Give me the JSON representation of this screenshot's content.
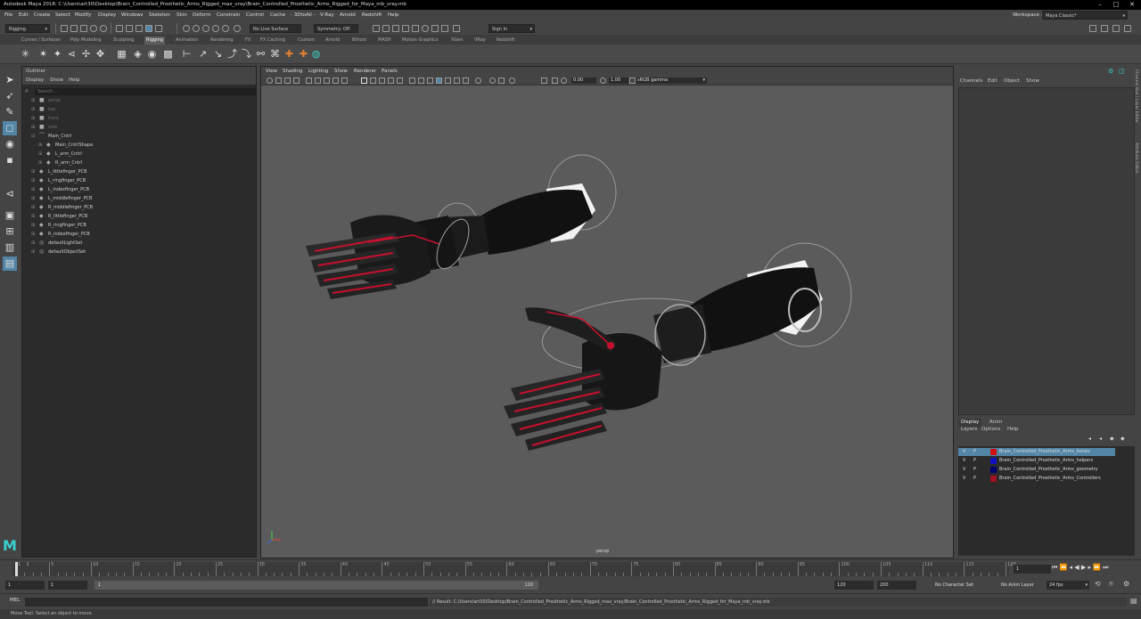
{
  "window": {
    "title": "Autodesk Maya 2018: C:\\Users\\art30\\Desktop\\Brain_Controlled_Prosthetic_Arms_Rigged_max_vray\\Brain_Controlled_Prosthetic_Arms_Rigged_for_Maya_mb_vray.mb"
  },
  "menubar": {
    "items": [
      "File",
      "Edit",
      "Create",
      "Select",
      "Modify",
      "Display",
      "Windows",
      "Skeleton",
      "Skin",
      "Deform",
      "Constrain",
      "Control",
      "Cache",
      "- 3DtoAll -",
      "V-Ray",
      "Arnold",
      "Redshift",
      "Help"
    ],
    "workspace_label": "Workspace :",
    "workspace_value": "Maya Classic*"
  },
  "toolbar": {
    "menuset": "Rigging",
    "live_surface": "No Live Surface",
    "symmetry": "Symmetry: Off",
    "sign_in": "Sign In"
  },
  "shelf": {
    "tabs": [
      "Curves / Surfaces",
      "Poly Modeling",
      "Sculpting",
      "Rigging",
      "Animation",
      "Rendering",
      "FX",
      "FX Caching",
      "Custom",
      "Arnold",
      "Bifrost",
      "MASH",
      "Motion Graphics",
      "XGen",
      "VRay",
      "Redshift"
    ],
    "active_tab": "Rigging"
  },
  "outliner": {
    "title": "Outliner",
    "menu": [
      "Display",
      "Show",
      "Help"
    ],
    "search_placeholder": "Search...",
    "items": [
      {
        "label": "persp",
        "dim": true,
        "indent": 0,
        "icon": "camera"
      },
      {
        "label": "top",
        "dim": true,
        "indent": 0,
        "icon": "camera"
      },
      {
        "label": "front",
        "dim": true,
        "indent": 0,
        "icon": "camera"
      },
      {
        "label": "side",
        "dim": true,
        "indent": 0,
        "icon": "camera"
      },
      {
        "label": "Main_Cntrl",
        "dim": false,
        "indent": 0,
        "icon": "curve",
        "expanded": true
      },
      {
        "label": "Main_CntrlShape",
        "dim": false,
        "indent": 1,
        "icon": "shape"
      },
      {
        "label": "L_arm_Cntrl",
        "dim": false,
        "indent": 1,
        "icon": "shape"
      },
      {
        "label": "R_arm_Cntrl",
        "dim": false,
        "indent": 1,
        "icon": "shape"
      },
      {
        "label": "L_littlefinger_PCB",
        "dim": false,
        "indent": 0,
        "icon": "shape"
      },
      {
        "label": "L_ringfinger_PCB",
        "dim": false,
        "indent": 0,
        "icon": "shape"
      },
      {
        "label": "L_indexfinger_PCB",
        "dim": false,
        "indent": 0,
        "icon": "shape"
      },
      {
        "label": "L_middlefinger_PCB",
        "dim": false,
        "indent": 0,
        "icon": "shape"
      },
      {
        "label": "R_middlefinger_PCB",
        "dim": false,
        "indent": 0,
        "icon": "shape"
      },
      {
        "label": "R_littlefinger_PCB",
        "dim": false,
        "indent": 0,
        "icon": "shape"
      },
      {
        "label": "R_ringfinger_PCB",
        "dim": false,
        "indent": 0,
        "icon": "shape"
      },
      {
        "label": "R_indexfinger_PCB",
        "dim": false,
        "indent": 0,
        "icon": "shape"
      },
      {
        "label": "defaultLightSet",
        "dim": false,
        "indent": 0,
        "icon": "set"
      },
      {
        "label": "defaultObjectSet",
        "dim": false,
        "indent": 0,
        "icon": "set"
      }
    ]
  },
  "viewport": {
    "menu": [
      "View",
      "Shading",
      "Lighting",
      "Show",
      "Renderer",
      "Panels"
    ],
    "exposure": "0.00",
    "gamma": "1.00",
    "colorspace": "sRGB gamma",
    "camera": "persp"
  },
  "channelbox": {
    "menu": [
      "Channels",
      "Edit",
      "Object",
      "Show"
    ],
    "side_tabs": [
      "Channel Box / Layer Editor",
      "Attribute Editor"
    ]
  },
  "layer_editor": {
    "tabs": [
      "Display",
      "Anim"
    ],
    "menu": [
      "Layers",
      "Options",
      "Help"
    ],
    "layers": [
      {
        "v": "V",
        "p": "P",
        "name": "Brain_Controlled_Prosthetic_Arms_bones",
        "color": "#d01010",
        "selected": true
      },
      {
        "v": "V",
        "p": "P",
        "name": "Brain_Controlled_Prosthetic_Arms_helpers",
        "color": "#1010c0",
        "selected": false
      },
      {
        "v": "V",
        "p": "P",
        "name": "Brain_Controlled_Prosthetic_Arms_geometry",
        "color": "#000070",
        "selected": false
      },
      {
        "v": "V",
        "p": "P",
        "name": "Brain_Controlled_Prosthetic_Arms_Controllers",
        "color": "#a01020",
        "selected": false
      }
    ]
  },
  "timeslider": {
    "ticks": [
      "1",
      "2",
      "5",
      "10",
      "15",
      "20",
      "25",
      "30",
      "35",
      "40",
      "45",
      "50",
      "55",
      "60",
      "65",
      "70",
      "75",
      "80",
      "85",
      "90",
      "95",
      "100",
      "105",
      "110",
      "115",
      "120"
    ],
    "current_frame": "1"
  },
  "range": {
    "start": "1",
    "inner_start": "1",
    "slider_start": "1",
    "slider_end": "120",
    "end": "120",
    "outer_end": "200",
    "character_set": "No Character Set",
    "anim_layer": "No Anim Layer",
    "fps": "24 fps"
  },
  "commandline": {
    "mode": "MEL",
    "result": "// Result: C:/Users/art30/Desktop/Brain_Controlled_Prosthetic_Arms_Rigged_max_vray/Brain_Controlled_Prosthetic_Arms_Rigged_for_Maya_mb_vray.mb"
  },
  "helpline": {
    "text": "Move Tool: Select an object to move."
  }
}
